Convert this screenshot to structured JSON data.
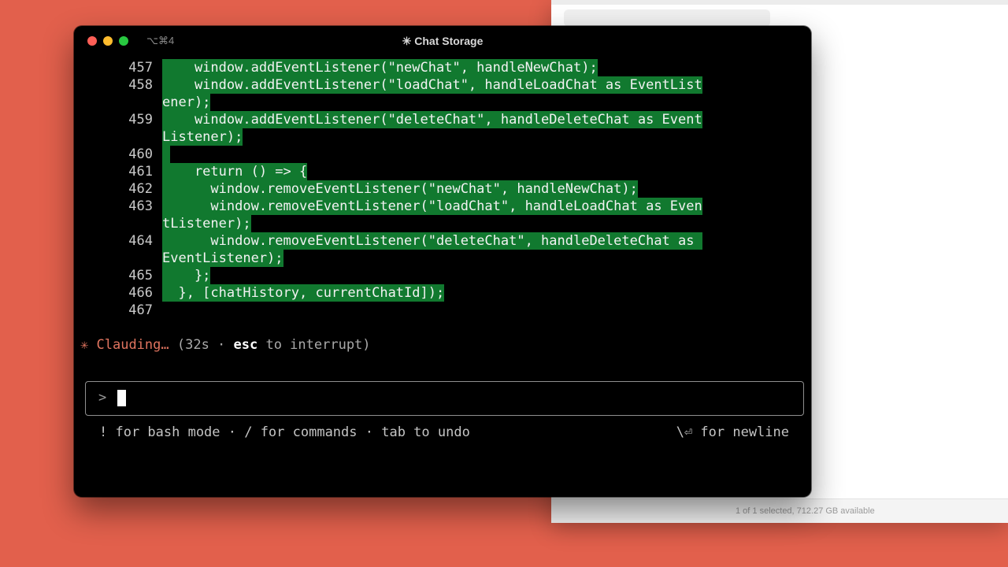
{
  "background_color": "#e2604c",
  "finder": {
    "status_text": "1 of 1 selected, 712.27 GB available"
  },
  "terminal": {
    "shortcut": "⌥⌘4",
    "title": "✳ Chat Storage",
    "highlight_color": "#11792f",
    "lines": [
      {
        "num": "457",
        "text": "    window.addEventListener(\"newChat\", handleNewChat);",
        "highlight": true
      },
      {
        "num": "458",
        "text": "    window.addEventListener(\"loadChat\", handleLoadChat as EventList",
        "highlight": true
      },
      {
        "num": "",
        "text": "ener);",
        "highlight": true,
        "wrap": true
      },
      {
        "num": "459",
        "text": "    window.addEventListener(\"deleteChat\", handleDeleteChat as Event",
        "highlight": true
      },
      {
        "num": "",
        "text": "Listener);",
        "highlight": true,
        "wrap": true
      },
      {
        "num": "460",
        "text": "",
        "highlight": true
      },
      {
        "num": "461",
        "text": "    return () => {",
        "highlight": true
      },
      {
        "num": "462",
        "text": "      window.removeEventListener(\"newChat\", handleNewChat);",
        "highlight": true
      },
      {
        "num": "463",
        "text": "      window.removeEventListener(\"loadChat\", handleLoadChat as Even",
        "highlight": true
      },
      {
        "num": "",
        "text": "tListener);",
        "highlight": true,
        "wrap": true
      },
      {
        "num": "464",
        "text": "      window.removeEventListener(\"deleteChat\", handleDeleteChat as ",
        "highlight": true
      },
      {
        "num": "",
        "text": "EventListener);",
        "highlight": true,
        "wrap": true
      },
      {
        "num": "465",
        "text": "    };",
        "highlight": true
      },
      {
        "num": "466",
        "text": "  }, [chatHistory, currentChatId]);",
        "highlight": true
      },
      {
        "num": "467",
        "text": "",
        "highlight": false
      }
    ],
    "status": {
      "spinner": "✳",
      "label": "Clauding…",
      "elapsed_prefix": " (32s · ",
      "esc_key": "esc",
      "elapsed_suffix": " to interrupt)"
    },
    "prompt": {
      "caret": ">",
      "value": ""
    },
    "help_left": "! for bash mode · / for commands · tab to undo",
    "help_right": "\\⏎ for newline"
  }
}
